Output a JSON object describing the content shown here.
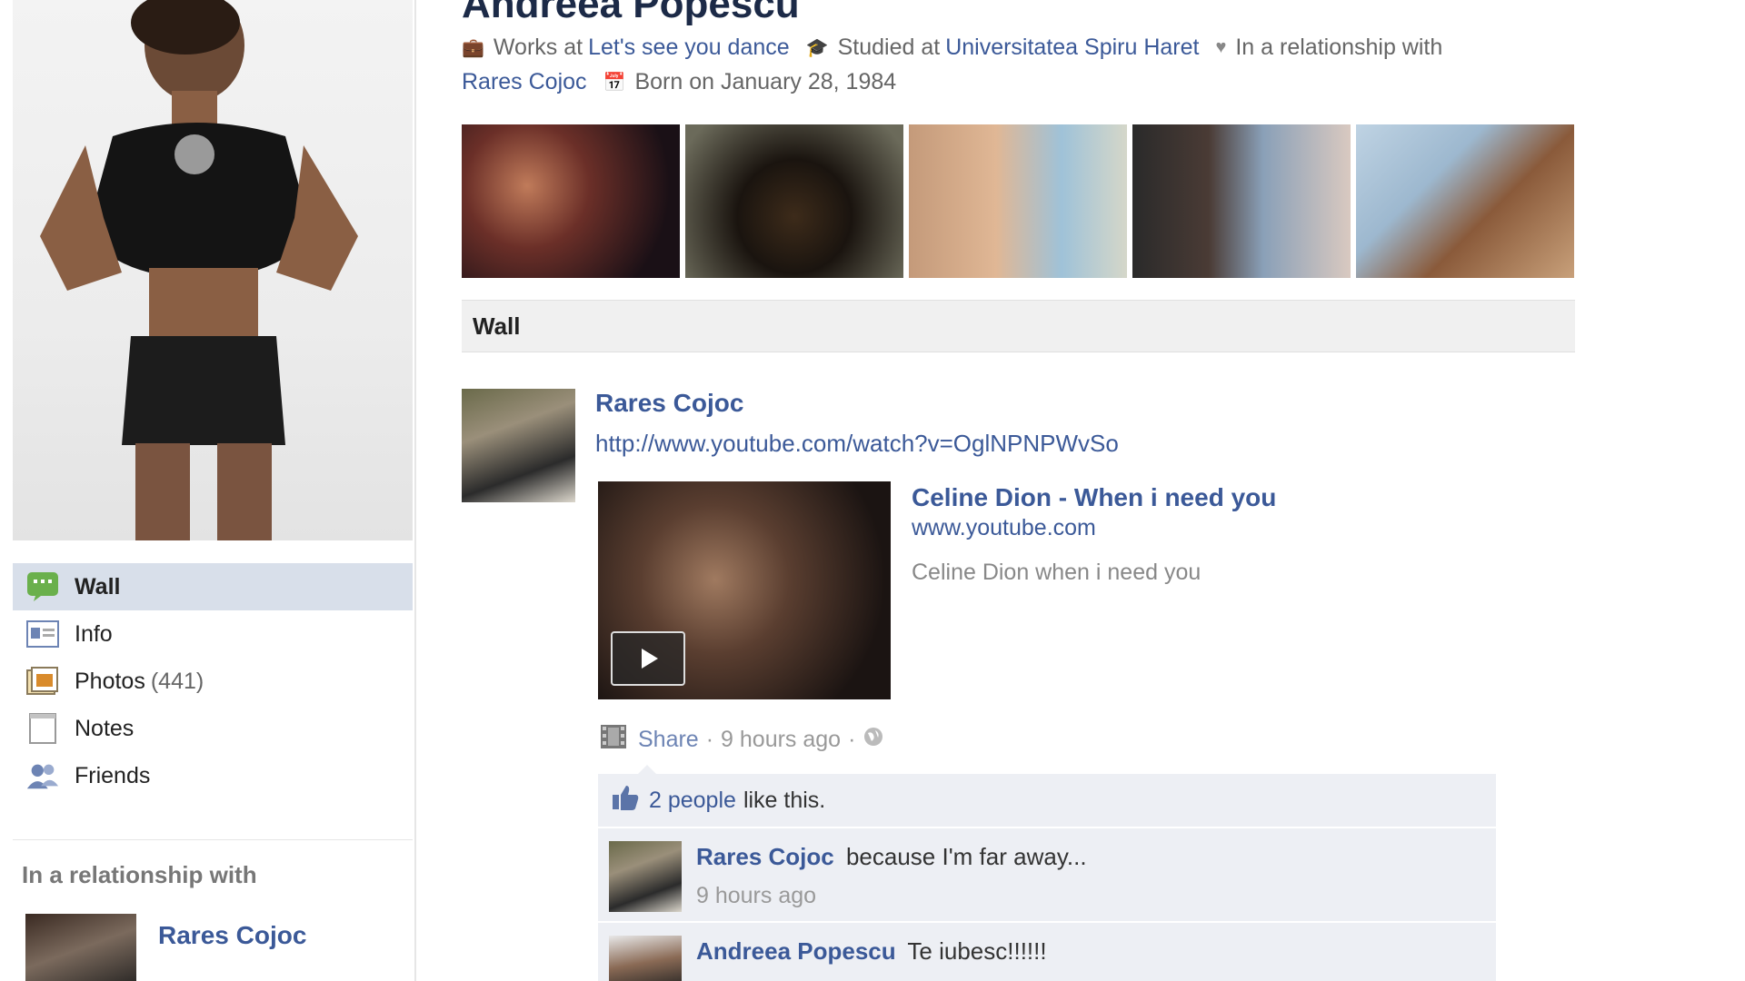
{
  "profile": {
    "name": "Andreea Popescu",
    "works_prefix": "Works at",
    "works_place": "Let's see you dance",
    "studied_prefix": "Studied at",
    "studied_place": "Universitatea Spiru Haret",
    "relationship_prefix": "In a relationship with",
    "relationship_partner": "Rares Cojoc",
    "born": "Born on January 28, 1984"
  },
  "sidebar": {
    "items": [
      {
        "label": "Wall",
        "icon": "wall-icon",
        "active": true
      },
      {
        "label": "Info",
        "icon": "info-icon"
      },
      {
        "label": "Photos",
        "count": "(441)",
        "icon": "photos-icon"
      },
      {
        "label": "Notes",
        "icon": "notes-icon"
      },
      {
        "label": "Friends",
        "icon": "friends-icon"
      }
    ],
    "relationship_heading": "In a relationship with",
    "relationship_name": "Rares Cojoc"
  },
  "wall_tab": "Wall",
  "post": {
    "author": "Rares Cojoc",
    "url": "http://www.youtube.com/watch?v=OglNPNPWvSo",
    "video_title": "Celine Dion - When i need you",
    "video_domain": "www.youtube.com",
    "video_desc": "Celine Dion when i need you",
    "share_label": "Share",
    "time": "9 hours ago",
    "likes_count": "2 people",
    "likes_suffix": "like this.",
    "comments": [
      {
        "author": "Rares Cojoc",
        "text": "because I'm far away...",
        "time": "9 hours ago"
      },
      {
        "author": "Andreea Popescu",
        "text": "Te iubesc!!!!!!",
        "time": ""
      }
    ]
  },
  "colors": {
    "link": "#3b5998",
    "active_nav": "#d8dfea",
    "comment_bg": "#edeff4"
  }
}
